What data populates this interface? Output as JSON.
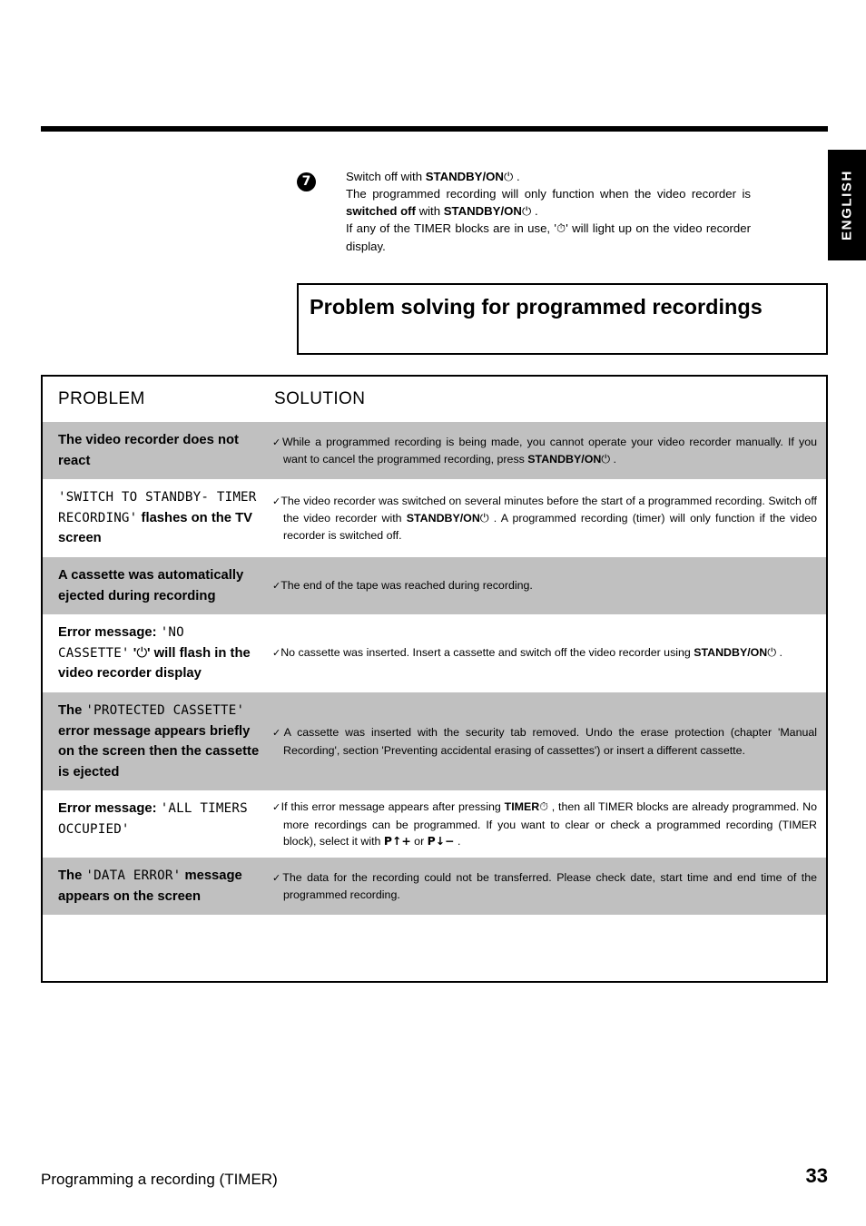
{
  "language_tab": {
    "label": "ENGLISH"
  },
  "step": {
    "number": "7",
    "line1_pre": "Switch off with ",
    "line1_bold": "STANDBY/ON",
    "line1_icon": "⏻",
    "line1_post": " .",
    "line2": "The programmed recording will only function when the video recorder is ",
    "line2_bold": "switched off",
    "line2_mid": " with ",
    "line2_bold2": "STANDBY/ON",
    "line2_icon": "⏻",
    "line2_post": " .",
    "line3_pre": "If any of the TIMER blocks are in use, '",
    "line3_icon": "⏱",
    "line3_post": "' will light up on the video recorder display."
  },
  "heading": {
    "title": "Problem solving for programmed recordings"
  },
  "table": {
    "headers": {
      "problem": "PROBLEM",
      "solution": "SOLUTION"
    },
    "rows": [
      {
        "shaded": true,
        "problem_parts": [
          {
            "type": "bold",
            "text": "The video recorder does not react"
          }
        ],
        "solution_parts": [
          {
            "type": "tick",
            "text": "✓"
          },
          {
            "type": "plain",
            "text": "While a programmed recording is being made, you cannot operate your video recorder manually. If you want to cancel the programmed recording, press "
          },
          {
            "type": "bold",
            "text": "STANDBY/ON"
          },
          {
            "type": "power",
            "text": "⏻"
          },
          {
            "type": "plain",
            "text": " ."
          }
        ]
      },
      {
        "shaded": false,
        "problem_parts": [
          {
            "type": "mono",
            "text": "'SWITCH TO STANDBY- TIMER RECORDING'"
          },
          {
            "type": "bold",
            "text": " flashes on the TV screen"
          }
        ],
        "solution_parts": [
          {
            "type": "tick",
            "text": "✓"
          },
          {
            "type": "plain",
            "text": "The video recorder was switched on several minutes before the start of a programmed recording. Switch off the video recorder with "
          },
          {
            "type": "bold",
            "text": "STANDBY/ON"
          },
          {
            "type": "power",
            "text": "⏻"
          },
          {
            "type": "plain",
            "text": " . A programmed recording (timer) will only function if the video recorder is switched off."
          }
        ]
      },
      {
        "shaded": true,
        "problem_parts": [
          {
            "type": "bold",
            "text": "A cassette was automatically ejected during recording"
          }
        ],
        "solution_parts": [
          {
            "type": "tick",
            "text": "✓"
          },
          {
            "type": "plain",
            "text": "The end of the tape was reached during recording."
          }
        ]
      },
      {
        "shaded": false,
        "problem_parts": [
          {
            "type": "bold",
            "text": "Error message: "
          },
          {
            "type": "mono",
            "text": "'NO CASSETTE'"
          },
          {
            "type": "bold",
            "text": " '"
          },
          {
            "type": "power",
            "text": "⏻"
          },
          {
            "type": "bold",
            "text": "' will flash in the video recorder display"
          }
        ],
        "solution_parts": [
          {
            "type": "tick",
            "text": "✓"
          },
          {
            "type": "plain",
            "text": "No cassette was inserted. Insert a cassette and switch off the video recorder using "
          },
          {
            "type": "bold",
            "text": "STANDBY/ON"
          },
          {
            "type": "power",
            "text": "⏻"
          },
          {
            "type": "plain",
            "text": " ."
          }
        ]
      },
      {
        "shaded": true,
        "problem_parts": [
          {
            "type": "bold",
            "text": "The "
          },
          {
            "type": "mono",
            "text": "'PROTECTED CASSETTE'"
          },
          {
            "type": "bold",
            "text": " error message appears briefly on the screen then the cassette is ejected"
          }
        ],
        "solution_parts": [
          {
            "type": "tick",
            "text": "✓"
          },
          {
            "type": "plain",
            "text": "A cassette was inserted with the security tab removed. Undo the erase protection (chapter 'Manual Recording', section 'Preventing accidental erasing of cassettes') or insert a different cassette."
          }
        ]
      },
      {
        "shaded": false,
        "problem_parts": [
          {
            "type": "bold",
            "text": "Error message: "
          },
          {
            "type": "mono",
            "text": "'ALL TIMERS OCCUPIED'"
          }
        ],
        "solution_parts": [
          {
            "type": "tick",
            "text": "✓"
          },
          {
            "type": "plain",
            "text": "If this error message appears after pressing "
          },
          {
            "type": "bold",
            "text": "TIMER"
          },
          {
            "type": "power",
            "text": "⏱"
          },
          {
            "type": "plain",
            "text": " , then all TIMER blocks are already programmed. No more recordings can be programmed. If you want to clear or check a programmed recording (TIMER block), select it with "
          },
          {
            "type": "arrow",
            "text": "P↑+"
          },
          {
            "type": "plain",
            "text": " or "
          },
          {
            "type": "arrow",
            "text": "P↓−"
          },
          {
            "type": "plain",
            "text": " ."
          }
        ]
      },
      {
        "shaded": true,
        "problem_parts": [
          {
            "type": "bold",
            "text": "The "
          },
          {
            "type": "mono",
            "text": "'DATA ERROR'"
          },
          {
            "type": "bold",
            "text": " message appears on the screen"
          }
        ],
        "solution_parts": [
          {
            "type": "tick",
            "text": "✓"
          },
          {
            "type": "plain",
            "text": "The data for the recording could not be transferred. Please check date, start time and end time of the programmed recording."
          }
        ]
      }
    ]
  },
  "footer": {
    "title": "Programming a recording (TIMER)",
    "page": "33"
  },
  "colors": {
    "shaded_row": "#c0c0c0",
    "rule": "#000000",
    "tab_bg": "#000000"
  }
}
